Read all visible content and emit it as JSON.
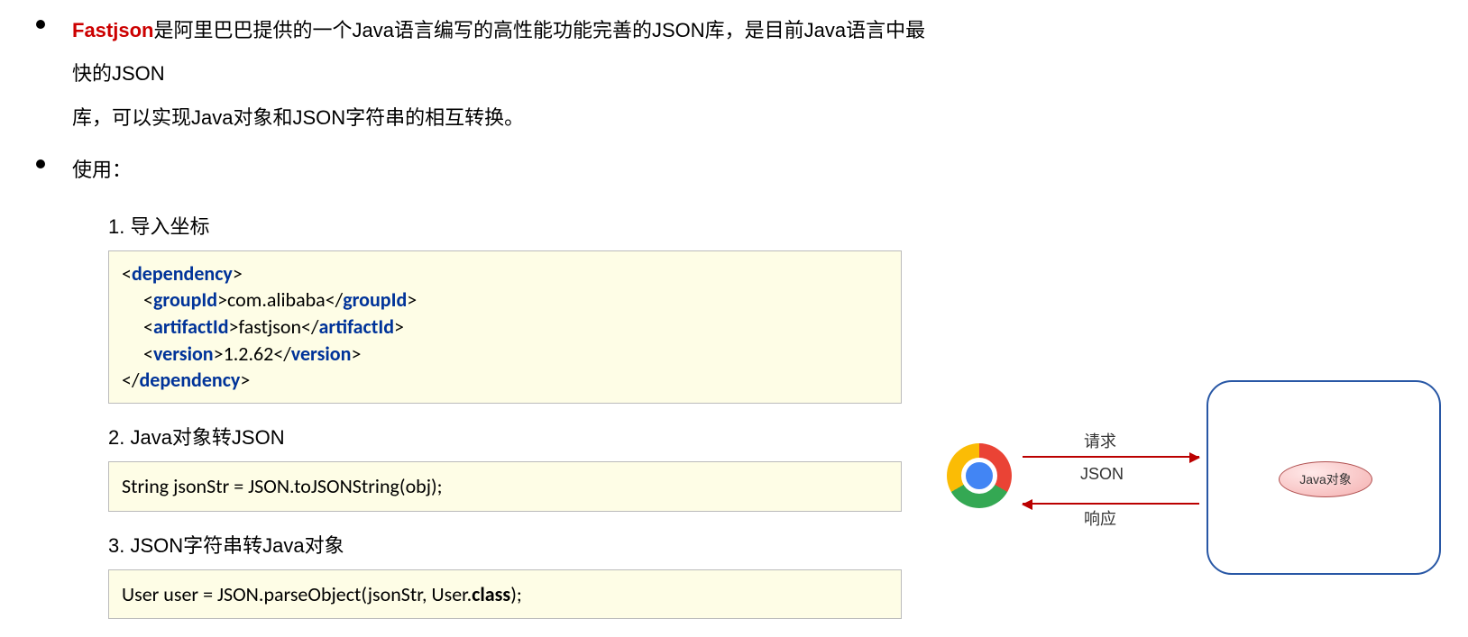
{
  "intro": {
    "highlight": "Fastjson",
    "rest1": "是阿里巴巴提供的一个Java语言编写的高性能功能完善的JSON库，是目前Java语言中最快的JSON",
    "rest2": "库，可以实现Java对象和JSON字符串的相互转换。"
  },
  "usage_label": "使用：",
  "steps": {
    "s1": "1. 导入坐标",
    "s2": "2. Java对象转JSON",
    "s3": "3. JSON字符串转Java对象"
  },
  "maven": {
    "dep_open": "dependency",
    "dep_close": "dependency",
    "group_tag": "groupId",
    "group_val": "com.alibaba",
    "artifact_tag": "artifactId",
    "artifact_val": "fastjson",
    "version_tag": "version",
    "version_val": "1.2.62"
  },
  "code2": {
    "pre": "String jsonStr = JSON.toJSONString(obj);"
  },
  "code3": {
    "pre": "User user = JSON.parseObject(jsonStr, User.",
    "kw": "class",
    "post": ");"
  },
  "diagram": {
    "request": "请求",
    "json": "JSON",
    "response": "响应",
    "java_obj": "Java对象"
  }
}
